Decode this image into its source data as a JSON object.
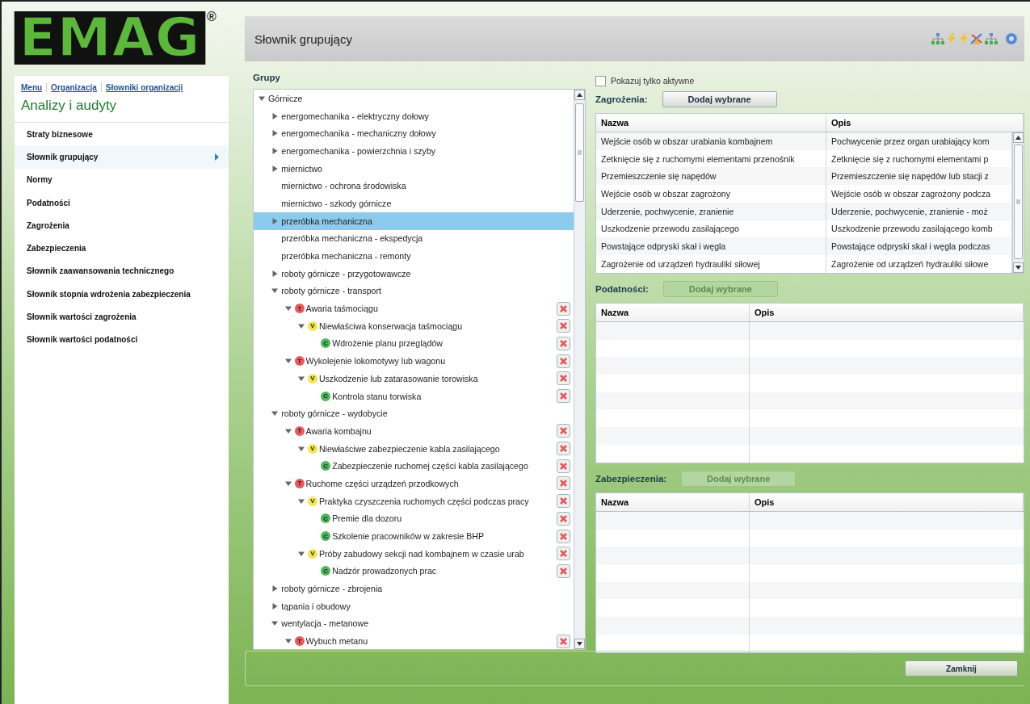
{
  "logo": {
    "text": "EMAG",
    "mark": "®"
  },
  "breadcrumbs": [
    "Menu",
    "Organizacja",
    "Słowniki organizacji"
  ],
  "sidebar": {
    "title": "Analizy i audyty",
    "items": [
      {
        "label": "Straty biznesowe",
        "selected": false
      },
      {
        "label": "Słownik grupujący",
        "selected": true
      },
      {
        "label": "Normy",
        "selected": false
      },
      {
        "label": "Podatności",
        "selected": false
      },
      {
        "label": "Zagrożenia",
        "selected": false
      },
      {
        "label": "Zabezpieczenia",
        "selected": false
      },
      {
        "label": "Słownik zaawansowania technicznego",
        "selected": false
      },
      {
        "label": "Słownik stopnia wdrożenia zabezpieczenia",
        "selected": false
      },
      {
        "label": "Słownik wartości zagrożenia",
        "selected": false
      },
      {
        "label": "Słownik wartości podatności",
        "selected": false
      }
    ]
  },
  "header": {
    "title": "Słownik grupujący"
  },
  "groups": {
    "title": "Grupy",
    "tree": [
      {
        "kind": "group",
        "label": "Górnicze",
        "expanded": true,
        "selected": false,
        "children": [
          {
            "kind": "group",
            "label": "energomechanika - elektryczny dołowy",
            "expanded": false,
            "selected": false
          },
          {
            "kind": "group",
            "label": "energomechanika - mechaniczny dołowy",
            "expanded": false,
            "selected": false
          },
          {
            "kind": "group",
            "label": "energomechanika - powierzchnia i szyby",
            "expanded": false,
            "selected": false
          },
          {
            "kind": "group",
            "label": "miernictwo",
            "expanded": false,
            "selected": false
          },
          {
            "kind": "leaf",
            "label": "miernictwo - ochrona środowiska",
            "selected": false
          },
          {
            "kind": "leaf",
            "label": "miernictwo - szkody górnicze",
            "selected": false
          },
          {
            "kind": "group",
            "label": "przeróbka mechaniczna",
            "expanded": false,
            "selected": true
          },
          {
            "kind": "leaf",
            "label": "przeróbka mechaniczna - ekspedycja",
            "selected": false
          },
          {
            "kind": "leaf",
            "label": "przeróbka mechaniczna - remonty",
            "selected": false
          },
          {
            "kind": "group",
            "label": "roboty górnicze - przygotowawcze",
            "expanded": false,
            "selected": false
          },
          {
            "kind": "group",
            "label": "roboty górnicze - transport",
            "expanded": true,
            "selected": false,
            "children": [
              {
                "kind": "threat",
                "badge": "T",
                "label": "Awaria taśmociągu",
                "expanded": true,
                "selected": false,
                "children": [
                  {
                    "kind": "vulnerability",
                    "badge": "V",
                    "label": "Niewłaściwa konserwacja taśmociągu",
                    "expanded": true,
                    "selected": false,
                    "children": [
                      {
                        "kind": "control",
                        "badge": "C",
                        "label": "Wdrożenie planu przeglądów",
                        "selected": false
                      }
                    ]
                  }
                ]
              },
              {
                "kind": "threat",
                "badge": "T",
                "label": "Wykolejenie lokomotywy lub wagonu",
                "expanded": true,
                "selected": false,
                "children": [
                  {
                    "kind": "vulnerability",
                    "badge": "V",
                    "label": "Uszkodzenie lub zatarasowanie torowiska",
                    "expanded": true,
                    "selected": false,
                    "children": [
                      {
                        "kind": "control",
                        "badge": "C",
                        "label": "Kontrola stanu torwiska",
                        "selected": false
                      }
                    ]
                  }
                ]
              }
            ]
          },
          {
            "kind": "group",
            "label": "roboty górnicze - wydobycie",
            "expanded": true,
            "selected": false,
            "children": [
              {
                "kind": "threat",
                "badge": "T",
                "label": "Awaria kombajnu",
                "expanded": true,
                "selected": false,
                "children": [
                  {
                    "kind": "vulnerability",
                    "badge": "V",
                    "label": "Niewłaściwe zabezpieczenie kabla zasilającego",
                    "expanded": true,
                    "selected": false,
                    "children": [
                      {
                        "kind": "control",
                        "badge": "C",
                        "label": "Zabezpieczenie ruchomej części kabla zasilającego",
                        "selected": false
                      }
                    ]
                  }
                ]
              },
              {
                "kind": "threat",
                "badge": "T",
                "label": "Ruchome części urządzeń przodkowych",
                "expanded": true,
                "selected": false,
                "children": [
                  {
                    "kind": "vulnerability",
                    "badge": "V",
                    "label": "Praktyka czyszczenia ruchomych części podczas pracy",
                    "expanded": true,
                    "selected": false,
                    "children": [
                      {
                        "kind": "control",
                        "badge": "C",
                        "label": "Premie dla dozoru",
                        "selected": false
                      },
                      {
                        "kind": "control",
                        "badge": "C",
                        "label": "Szkolenie pracowników w zakresie BHP",
                        "selected": false
                      }
                    ]
                  },
                  {
                    "kind": "vulnerability",
                    "badge": "V",
                    "label": "Próby zabudowy sekcji nad kombajnem w czasie urab",
                    "expanded": true,
                    "selected": false,
                    "children": [
                      {
                        "kind": "control",
                        "badge": "C",
                        "label": "Nadzór prowadzonych prac",
                        "selected": false
                      }
                    ]
                  }
                ]
              }
            ]
          },
          {
            "kind": "group",
            "label": "roboty górnicze - zbrojenia",
            "expanded": false,
            "selected": false
          },
          {
            "kind": "group",
            "label": "tąpania i obudowy",
            "expanded": false,
            "selected": false
          },
          {
            "kind": "group",
            "label": "wentylacja - metanowe",
            "expanded": true,
            "selected": false,
            "children": [
              {
                "kind": "threat",
                "badge": "T",
                "label": "Wybuch metanu",
                "expanded": true,
                "selected": false
              }
            ]
          }
        ]
      }
    ]
  },
  "filter": {
    "label": "Pokazuj tylko aktywne",
    "checked": false
  },
  "sections": [
    {
      "title": "Zagrożenia:",
      "button": {
        "label": "Dodaj wybrane",
        "disabled": false
      },
      "columns": [
        "Nazwa",
        "Opis"
      ],
      "scrollable": true,
      "rows": [
        [
          "Wejście osób w obszar urabiania kombajnem",
          "Pochwycenie przez organ urabiający kom"
        ],
        [
          "Zetknięcie się z ruchomymi elementami przenośnik",
          "Zetknięcie się z ruchomymi elementami p"
        ],
        [
          "Przemieszczenie się napędów",
          "Przemieszczenie się napędów lub stacji z"
        ],
        [
          "Wejście osób w obszar zagrożony",
          "Wejście osób w obszar zagrożony podcza"
        ],
        [
          "Uderzenie, pochwycenie, zranienie",
          "Uderzenie, pochwycenie, zranienie - moż"
        ],
        [
          "Uszkodzenie przewodu zasilającego",
          "Uszkodzenie przewodu zasilającego komb"
        ],
        [
          "Powstające odpryski skał i węgla",
          "Powstające odpryski skał i węgla podczas"
        ],
        [
          "Zagrożenie od urządzeń hydrauliki siłowej",
          "Zagrożenie od urządzeń hydrauliki siłowe"
        ]
      ]
    },
    {
      "title": "Podatności:",
      "button": {
        "label": "Dodaj wybrane",
        "disabled": true
      },
      "columns": [
        "Nazwa",
        "Opis"
      ],
      "scrollable": false
    },
    {
      "title": "Zabezpieczenia:",
      "button": {
        "label": "Dodaj wybrane",
        "disabled": true
      },
      "columns": [
        "Nazwa",
        "Opis"
      ],
      "scrollable": false
    }
  ],
  "footer": {
    "button": "Zamknij"
  }
}
